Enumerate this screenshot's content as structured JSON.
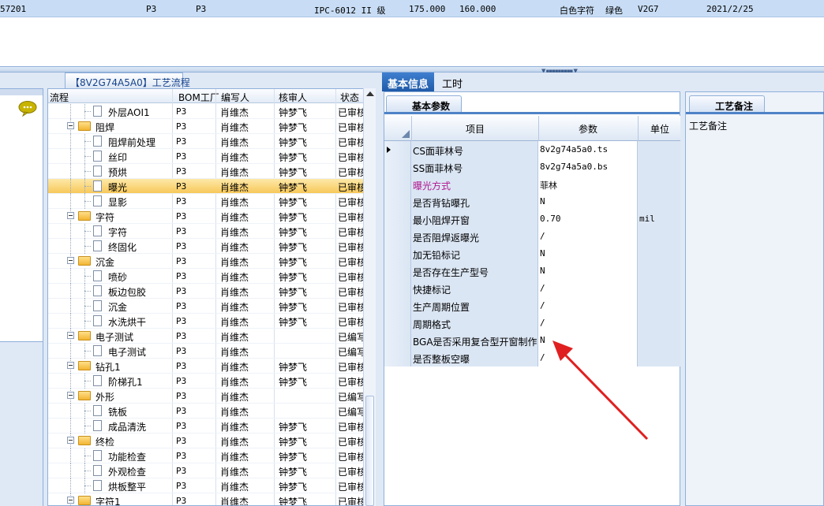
{
  "top_row": {
    "cells": [
      "57201",
      "P3",
      "P3",
      "IPC-6012 II 级",
      "175.000",
      "160.000",
      "白色字符",
      "绿色",
      "V2G7",
      "2021/2/25"
    ]
  },
  "left_panel": {
    "icon": "chat-bubble-icon"
  },
  "tree": {
    "tab_label": "【8V2G74A5A0】工艺流程",
    "headers": [
      "流程",
      "BOM工厂",
      "编写人",
      "核审人",
      "状态"
    ],
    "rows": [
      {
        "name": "外层AOI1",
        "level": 2,
        "type": "doc",
        "bom": "P3",
        "writer": "肖维杰",
        "reviewer": "钟梦飞",
        "status": "已审核"
      },
      {
        "name": "阻焊",
        "level": 1,
        "type": "folder",
        "bom": "P3",
        "writer": "肖维杰",
        "reviewer": "钟梦飞",
        "status": "已审核"
      },
      {
        "name": "阻焊前处理",
        "level": 2,
        "type": "doc",
        "bom": "P3",
        "writer": "肖维杰",
        "reviewer": "钟梦飞",
        "status": "已审核"
      },
      {
        "name": "丝印",
        "level": 2,
        "type": "doc",
        "bom": "P3",
        "writer": "肖维杰",
        "reviewer": "钟梦飞",
        "status": "已审核"
      },
      {
        "name": "预烘",
        "level": 2,
        "type": "doc",
        "bom": "P3",
        "writer": "肖维杰",
        "reviewer": "钟梦飞",
        "status": "已审核"
      },
      {
        "name": "曝光",
        "level": 2,
        "type": "doc",
        "bom": "P3",
        "writer": "肖维杰",
        "reviewer": "钟梦飞",
        "status": "已审核",
        "selected": true
      },
      {
        "name": "显影",
        "level": 2,
        "type": "doc",
        "bom": "P3",
        "writer": "肖维杰",
        "reviewer": "钟梦飞",
        "status": "已审核"
      },
      {
        "name": "字符",
        "level": 1,
        "type": "folder",
        "bom": "P3",
        "writer": "肖维杰",
        "reviewer": "钟梦飞",
        "status": "已审核"
      },
      {
        "name": "字符",
        "level": 2,
        "type": "doc",
        "bom": "P3",
        "writer": "肖维杰",
        "reviewer": "钟梦飞",
        "status": "已审核"
      },
      {
        "name": "终固化",
        "level": 2,
        "type": "doc",
        "bom": "P3",
        "writer": "肖维杰",
        "reviewer": "钟梦飞",
        "status": "已审核"
      },
      {
        "name": "沉金",
        "level": 1,
        "type": "folder",
        "bom": "P3",
        "writer": "肖维杰",
        "reviewer": "钟梦飞",
        "status": "已审核"
      },
      {
        "name": "喷砂",
        "level": 2,
        "type": "doc",
        "bom": "P3",
        "writer": "肖维杰",
        "reviewer": "钟梦飞",
        "status": "已审核"
      },
      {
        "name": "板边包胶",
        "level": 2,
        "type": "doc",
        "bom": "P3",
        "writer": "肖维杰",
        "reviewer": "钟梦飞",
        "status": "已审核"
      },
      {
        "name": "沉金",
        "level": 2,
        "type": "doc",
        "bom": "P3",
        "writer": "肖维杰",
        "reviewer": "钟梦飞",
        "status": "已审核"
      },
      {
        "name": "水洗烘干",
        "level": 2,
        "type": "doc",
        "bom": "P3",
        "writer": "肖维杰",
        "reviewer": "钟梦飞",
        "status": "已审核"
      },
      {
        "name": "电子测试",
        "level": 1,
        "type": "folder",
        "bom": "P3",
        "writer": "肖维杰",
        "reviewer": "",
        "status": "已编写"
      },
      {
        "name": "电子测试",
        "level": 2,
        "type": "doc",
        "bom": "P3",
        "writer": "肖维杰",
        "reviewer": "",
        "status": "已编写"
      },
      {
        "name": "钻孔1",
        "level": 1,
        "type": "folder",
        "bom": "P3",
        "writer": "肖维杰",
        "reviewer": "钟梦飞",
        "status": "已审核"
      },
      {
        "name": "阶梯孔1",
        "level": 2,
        "type": "doc",
        "bom": "P3",
        "writer": "肖维杰",
        "reviewer": "钟梦飞",
        "status": "已审核"
      },
      {
        "name": "外形",
        "level": 1,
        "type": "folder",
        "bom": "P3",
        "writer": "肖维杰",
        "reviewer": "",
        "status": "已编写"
      },
      {
        "name": "铣板",
        "level": 2,
        "type": "doc",
        "bom": "P3",
        "writer": "肖维杰",
        "reviewer": "",
        "status": "已编写"
      },
      {
        "name": "成品清洗",
        "level": 2,
        "type": "doc",
        "bom": "P3",
        "writer": "肖维杰",
        "reviewer": "钟梦飞",
        "status": "已审核"
      },
      {
        "name": "终检",
        "level": 1,
        "type": "folder",
        "bom": "P3",
        "writer": "肖维杰",
        "reviewer": "钟梦飞",
        "status": "已审核"
      },
      {
        "name": "功能检查",
        "level": 2,
        "type": "doc",
        "bom": "P3",
        "writer": "肖维杰",
        "reviewer": "钟梦飞",
        "status": "已审核"
      },
      {
        "name": "外观检查",
        "level": 2,
        "type": "doc",
        "bom": "P3",
        "writer": "肖维杰",
        "reviewer": "钟梦飞",
        "status": "已审核"
      },
      {
        "name": "烘板整平",
        "level": 2,
        "type": "doc",
        "bom": "P3",
        "writer": "肖维杰",
        "reviewer": "钟梦飞",
        "status": "已审核"
      },
      {
        "name": "字符1",
        "level": 1,
        "type": "folder",
        "bom": "P3",
        "writer": "肖维杰",
        "reviewer": "钟梦飞",
        "status": "已审核"
      }
    ]
  },
  "right_tabs": {
    "basic": "基本信息",
    "hours": "工时"
  },
  "basic_params": {
    "subtab": "基本参数",
    "headers": {
      "item": "项目",
      "param": "参数",
      "unit": "单位"
    },
    "rows": [
      {
        "item": "CS面菲林号",
        "param": "8v2g74a5a0.ts",
        "unit": "",
        "pointer": true
      },
      {
        "item": "SS面菲林号",
        "param": "8v2g74a5a0.bs",
        "unit": ""
      },
      {
        "item": "曝光方式",
        "param": "菲林",
        "unit": "",
        "color": "#b0178f"
      },
      {
        "item": "是否背钻曝孔",
        "param": "N",
        "unit": ""
      },
      {
        "item": "最小阻焊开窗",
        "param": "0.70",
        "unit": "mil"
      },
      {
        "item": "是否阻焊返曝光",
        "param": "/",
        "unit": ""
      },
      {
        "item": "加无铅标记",
        "param": "N",
        "unit": ""
      },
      {
        "item": "是否存在生产型号",
        "param": "N",
        "unit": ""
      },
      {
        "item": "快捷标记",
        "param": "/",
        "unit": ""
      },
      {
        "item": "生产周期位置",
        "param": "/",
        "unit": ""
      },
      {
        "item": "周期格式",
        "param": "/",
        "unit": ""
      },
      {
        "item": "BGA是否采用复合型开窗制作",
        "param": "N",
        "unit": ""
      },
      {
        "item": "是否整板空曝",
        "param": "/",
        "unit": ""
      }
    ]
  },
  "notes": {
    "subtab": "工艺备注",
    "label": "工艺备注"
  },
  "annotation": {
    "type": "red-arrow",
    "color": "#e02020"
  }
}
